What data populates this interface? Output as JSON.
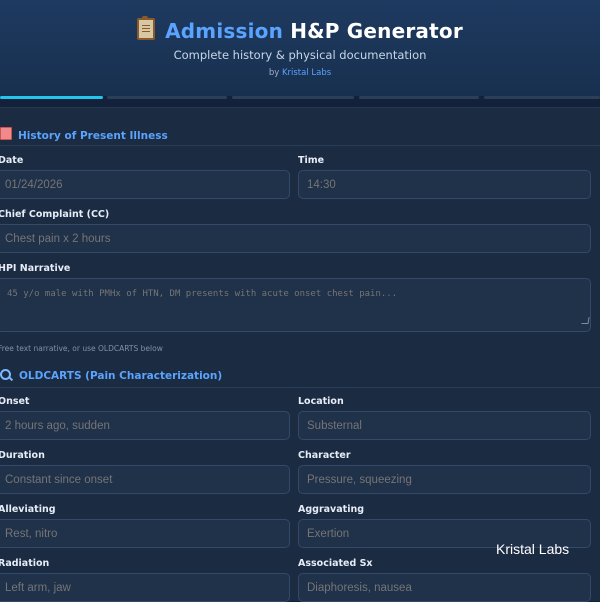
{
  "header": {
    "title_accent": "Admission",
    "title_rest": "H&P Generator",
    "subtitle": "Complete history & physical documentation",
    "byline_prefix": "by",
    "byline_brand": "Kristal Labs",
    "icon": "clipboard-icon"
  },
  "progress": {
    "steps": 5,
    "current_step": 1
  },
  "hpi_section": {
    "title": "History of Present Illness",
    "icon": "clipboard-pad-icon",
    "date": {
      "label": "Date",
      "value": "01/24/2026"
    },
    "time": {
      "label": "Time",
      "value": "14:30"
    },
    "chief_complaint": {
      "label": "Chief Complaint (CC)",
      "placeholder": "Chest pain x 2 hours"
    },
    "narrative": {
      "label": "HPI Narrative",
      "placeholder": "45 y/o male with PMHx of HTN, DM presents with acute onset chest pain...",
      "hint": "Free text narrative, or use OLDCARTS below"
    }
  },
  "oldcarts_section": {
    "title": "OLDCARTS (Pain Characterization)",
    "icon": "magnifier-icon",
    "onset": {
      "label": "Onset",
      "placeholder": "2 hours ago, sudden"
    },
    "location": {
      "label": "Location",
      "placeholder": "Substernal"
    },
    "duration": {
      "label": "Duration",
      "placeholder": "Constant since onset"
    },
    "character": {
      "label": "Character",
      "placeholder": "Pressure, squeezing"
    },
    "alleviating": {
      "label": "Alleviating",
      "placeholder": "Rest, nitro"
    },
    "aggravating": {
      "label": "Aggravating",
      "placeholder": "Exertion"
    },
    "radiation": {
      "label": "Radiation",
      "placeholder": "Left arm, jaw"
    },
    "associated_sx": {
      "label": "Associated Sx",
      "placeholder": "Diaphoresis, nausea"
    }
  },
  "watermark": "Kristal Labs",
  "colors": {
    "accent": "#5aa3ff",
    "progress_active": "#22c6ea",
    "background": "#13223a",
    "card": "#1b2b42"
  }
}
